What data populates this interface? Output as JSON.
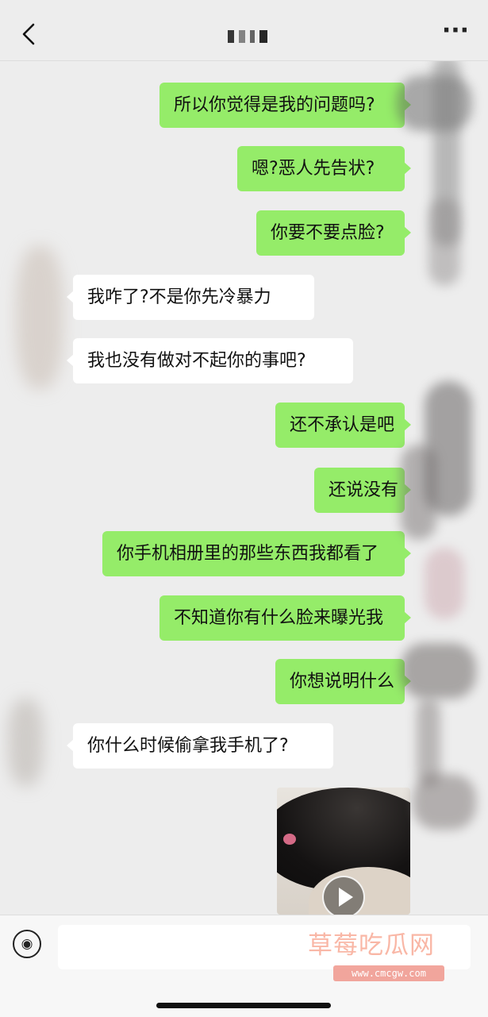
{
  "header": {
    "title": "",
    "back_icon": "chevron-left-icon",
    "more_icon": "more-dots-icon"
  },
  "messages": [
    {
      "side": "sent",
      "text": "所以你觉得是我的问题吗?"
    },
    {
      "side": "sent",
      "text": "嗯?恶人先告状?"
    },
    {
      "side": "sent",
      "text": "你要不要点脸?"
    },
    {
      "side": "received",
      "text": "我咋了?不是你先冷暴力"
    },
    {
      "side": "received",
      "text": "我也没有做对不起你的事吧?"
    },
    {
      "side": "sent",
      "text": "还不承认是吧"
    },
    {
      "side": "sent",
      "text": "还说没有"
    },
    {
      "side": "sent",
      "text": "你手机相册里的那些东西我都看了"
    },
    {
      "side": "sent",
      "text": "不知道你有什么脸来曝光我"
    },
    {
      "side": "sent",
      "text": "你想说明什么"
    },
    {
      "side": "received",
      "text": "你什么时候偷拿我手机了?"
    }
  ],
  "video_message": {
    "side": "sent",
    "icon": "play-icon"
  },
  "input_bar": {
    "voice_icon": "voice-icon",
    "placeholder": ""
  },
  "watermark": {
    "main": "草莓吃瓜网",
    "sub": "www.cmcgw.com"
  },
  "colors": {
    "sent_bubble": "#95ec69",
    "received_bubble": "#ffffff",
    "background": "#ededed",
    "watermark": "#f8aa96"
  }
}
